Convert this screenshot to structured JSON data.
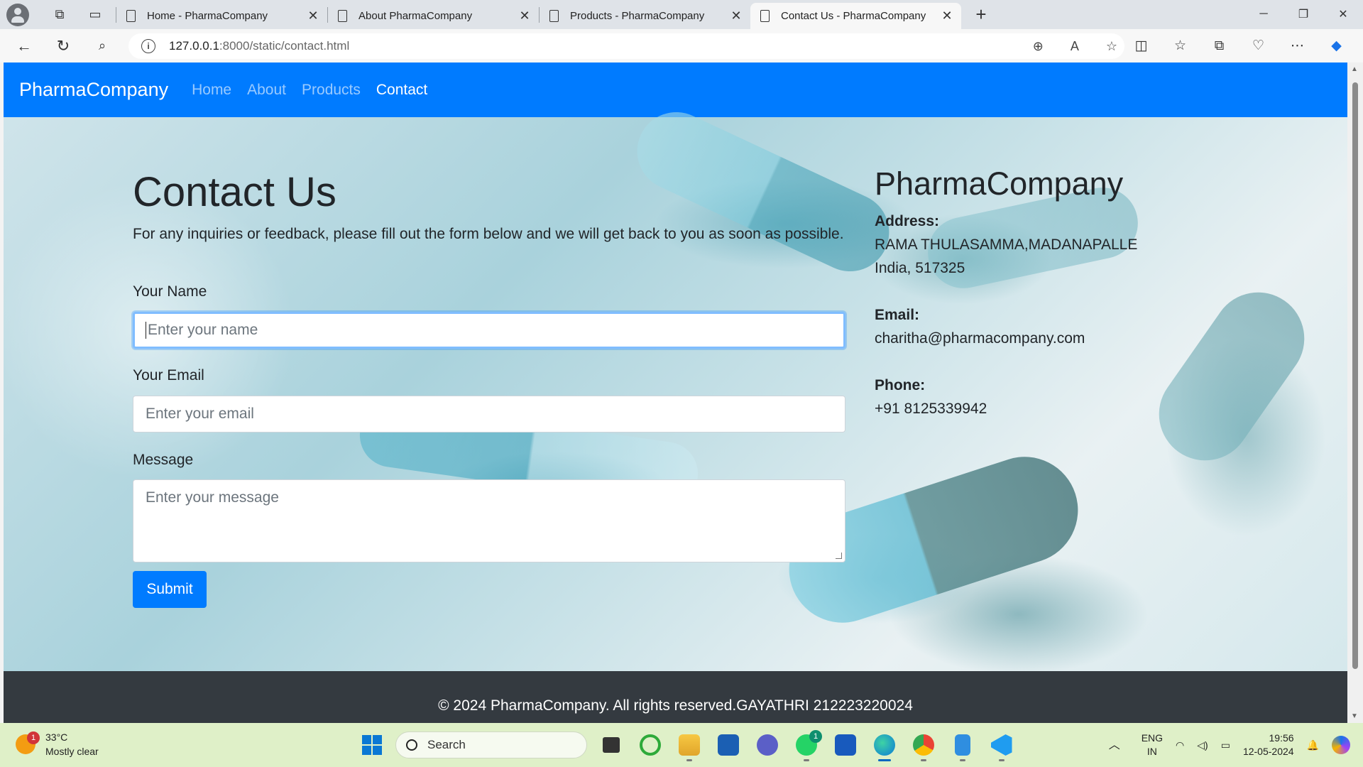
{
  "browser": {
    "tabs": [
      {
        "label": "Home - PharmaCompany",
        "active": false
      },
      {
        "label": "About PharmaCompany",
        "active": false
      },
      {
        "label": "Products - PharmaCompany",
        "active": false
      },
      {
        "label": "Contact Us - PharmaCompany",
        "active": true
      }
    ],
    "url": {
      "host": "127.0.0.1",
      "path": ":8000/static/contact.html"
    }
  },
  "navbar": {
    "brand": "PharmaCompany",
    "links": [
      {
        "label": "Home",
        "active": false
      },
      {
        "label": "About",
        "active": false
      },
      {
        "label": "Products",
        "active": false
      },
      {
        "label": "Contact",
        "active": true
      }
    ]
  },
  "contact": {
    "title": "Contact Us",
    "lead": "For any inquiries or feedback, please fill out the form below and we will get back to you as soon as possible.",
    "name_label": "Your Name",
    "name_placeholder": "Enter your name",
    "email_label": "Your Email",
    "email_placeholder": "Enter your email",
    "message_label": "Message",
    "message_placeholder": "Enter your message",
    "submit_label": "Submit"
  },
  "info": {
    "company": "PharmaCompany",
    "address_label": "Address:",
    "address_line1": "RAMA THULASAMMA,MADANAPALLE",
    "address_line2": "India, 517325",
    "email_label": "Email:",
    "email": "charitha@pharmacompany.com",
    "phone_label": "Phone:",
    "phone": "+91 8125339942"
  },
  "footer": {
    "text": "© 2024 PharmaCompany. All rights reserved.GAYATHRI 212223220024"
  },
  "taskbar": {
    "weather": {
      "temp": "33°C",
      "condition": "Mostly clear",
      "badge": "1"
    },
    "search_label": "Search",
    "lang": {
      "line1": "ENG",
      "line2": "IN"
    },
    "clock": {
      "time": "19:56",
      "date": "12-05-2024"
    },
    "whatsapp_badge": "1"
  },
  "colors": {
    "primary": "#007bff",
    "footer": "#343a40"
  }
}
